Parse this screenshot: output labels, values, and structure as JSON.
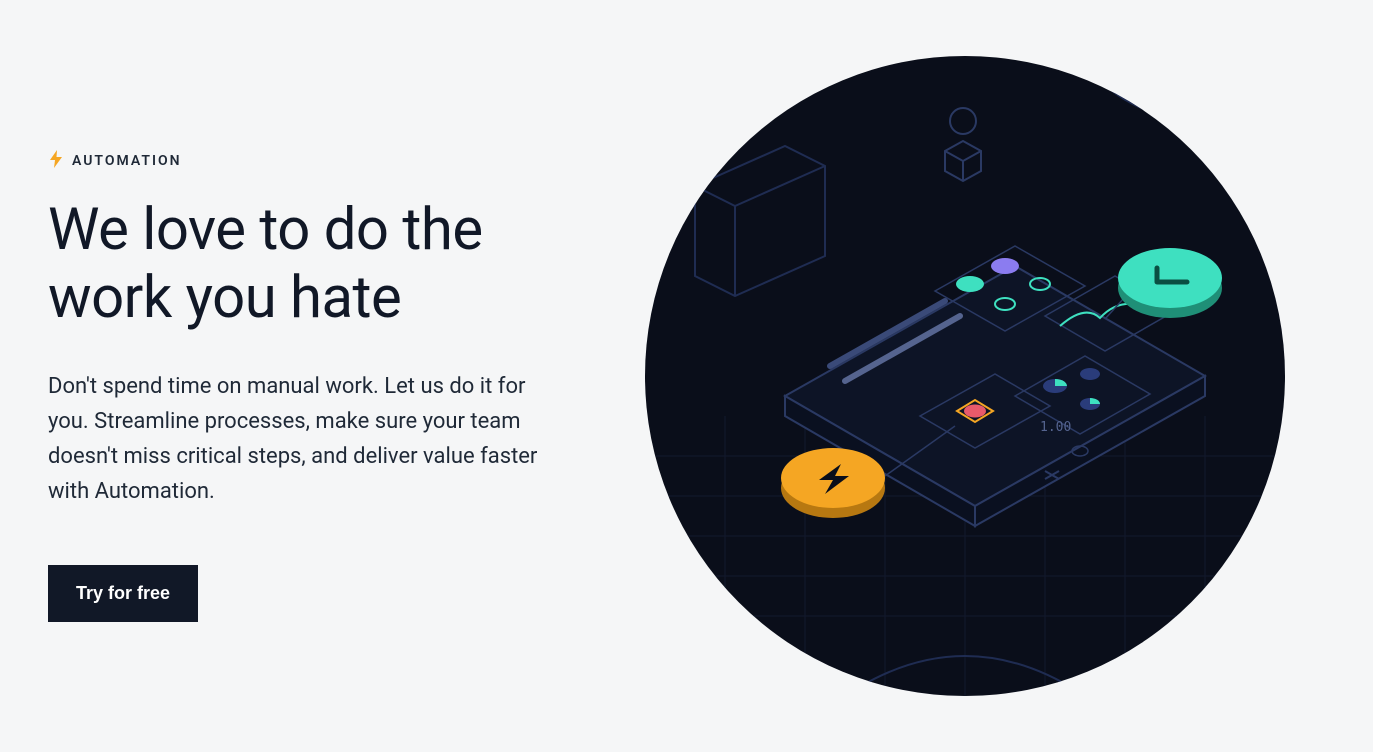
{
  "hero": {
    "eyebrow_label": "AUTOMATION",
    "heading": "We love to do the work you hate",
    "body": "Don't spend time on manual work. Let us do it for you. Streamline processes, make sure your team doesn't miss critical steps, and deliver value faster with Automation.",
    "cta_label": "Try for free"
  },
  "illustration": {
    "value_label": "1.00"
  },
  "colors": {
    "accent_yellow": "#f5a623",
    "accent_teal": "#3ee0c0",
    "dark_bg": "#0a0e1a",
    "page_bg": "#f5f6f7",
    "text": "#111827"
  }
}
